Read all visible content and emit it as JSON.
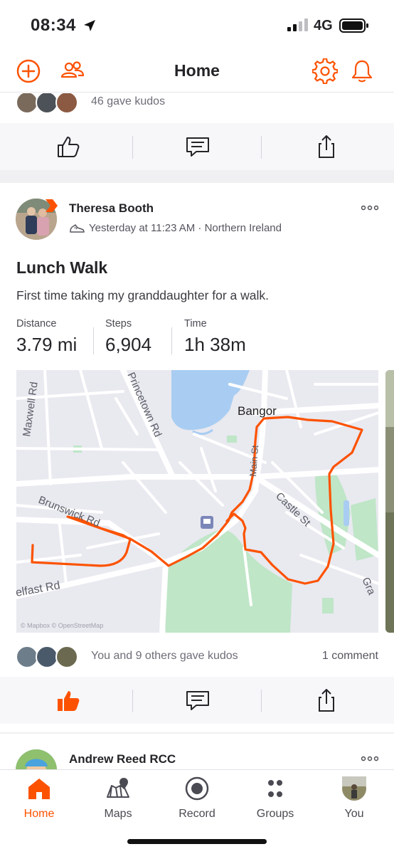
{
  "status": {
    "time": "08:34",
    "network": "4G"
  },
  "header": {
    "title": "Home"
  },
  "previous_post": {
    "kudos_text": "46 gave kudos"
  },
  "post": {
    "athlete_name": "Theresa Booth",
    "meta": "Yesterday at 11:23 AM · Northern Ireland",
    "title": "Lunch Walk",
    "description": "First time taking my granddaughter for a walk.",
    "stats": [
      {
        "label": "Distance",
        "value": "3.79 mi"
      },
      {
        "label": "Steps",
        "value": "6,904"
      },
      {
        "label": "Time",
        "value": "1h 38m"
      }
    ],
    "map": {
      "labels": {
        "maxwell": "Maxwell Rd",
        "princetown": "Princetown Rd",
        "bangor": "Bangor",
        "brunswick": "Brunswick Rd",
        "castle": "Castle St",
        "belfast": "elfast Rd",
        "main": "Main St",
        "gra": "Gra",
        "attribution": "© Mapbox © OpenStreetMap"
      },
      "route_color": "#fc5200"
    },
    "kudos_text": "You and 9 others gave kudos",
    "comments_text": "1 comment"
  },
  "next_post": {
    "athlete_name": "Andrew Reed RCC"
  },
  "tabs": [
    {
      "label": "Home"
    },
    {
      "label": "Maps"
    },
    {
      "label": "Record"
    },
    {
      "label": "Groups"
    },
    {
      "label": "You"
    }
  ],
  "colors": {
    "accent": "#fc5200",
    "text": "#242428"
  }
}
